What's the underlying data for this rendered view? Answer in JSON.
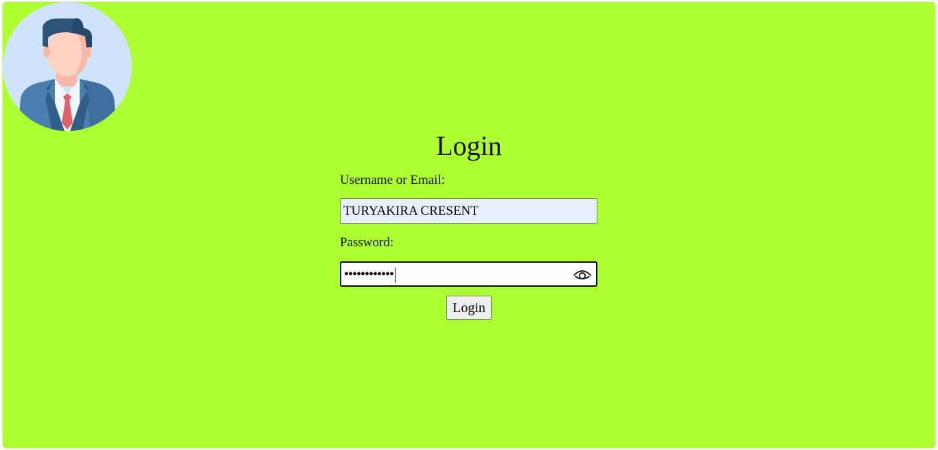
{
  "login_form": {
    "title": "Login",
    "username_label": "Username or Email:",
    "username_value": "TURYAKIRA CRESENT",
    "password_label": "Password:",
    "password_masked": "••••••••••••",
    "submit_label": "Login"
  },
  "icons": {
    "avatar": "user-avatar-icon",
    "toggle_password": "eye-icon"
  },
  "colors": {
    "background": "#adff2f",
    "username_field": "#e8f0fe",
    "button": "#efefef"
  }
}
